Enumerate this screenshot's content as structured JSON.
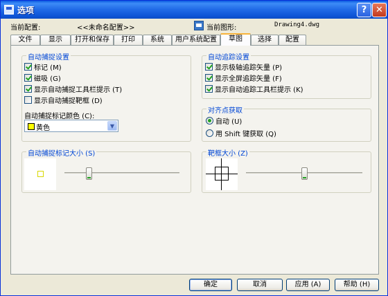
{
  "window": {
    "title": "选项"
  },
  "header": {
    "current_profile_label": "当前配置:",
    "current_profile_value": "<<未命名配置>>",
    "current_drawing_label": "当前图形:",
    "current_drawing_value": "Drawing4.dwg"
  },
  "tabs": [
    {
      "label": "文件"
    },
    {
      "label": "显示"
    },
    {
      "label": "打开和保存"
    },
    {
      "label": "打印"
    },
    {
      "label": "系统"
    },
    {
      "label": "用户系统配置"
    },
    {
      "label": "草图"
    },
    {
      "label": "选择"
    },
    {
      "label": "配置"
    }
  ],
  "active_tab": "草图",
  "autosnap": {
    "title": "自动捕捉设置",
    "options": [
      {
        "label": "标记 (M)",
        "checked": true
      },
      {
        "label": "磁吸 (G)",
        "checked": true
      },
      {
        "label": "显示自动捕捉工具栏提示 (T)",
        "checked": true
      },
      {
        "label": "显示自动捕捉靶框 (D)",
        "checked": false
      }
    ],
    "color_label": "自动捕捉标记颜色 (C):",
    "color_value": "黄色",
    "color_hex": "#ffff00"
  },
  "autotrack": {
    "title": "自动追踪设置",
    "options": [
      {
        "label": "显示极轴追踪矢量 (P)",
        "checked": true
      },
      {
        "label": "显示全屏追踪矢量 (F)",
        "checked": true
      },
      {
        "label": "显示自动追踪工具栏提示 (K)",
        "checked": true
      }
    ]
  },
  "alignment": {
    "title": "对齐点获取",
    "options": [
      {
        "label": "自动 (U)",
        "selected": true
      },
      {
        "label": "用 Shift 键获取 (Q)",
        "selected": false
      }
    ]
  },
  "marker_size": {
    "title": "自动捕捉标记大小 (S)",
    "level": 0.2
  },
  "aperture_size": {
    "title": "靶框大小 (Z)",
    "level": 0.5
  },
  "buttons": {
    "ok": "确定",
    "cancel": "取消",
    "apply": "应用 (A)",
    "help": "帮助 (H)"
  }
}
